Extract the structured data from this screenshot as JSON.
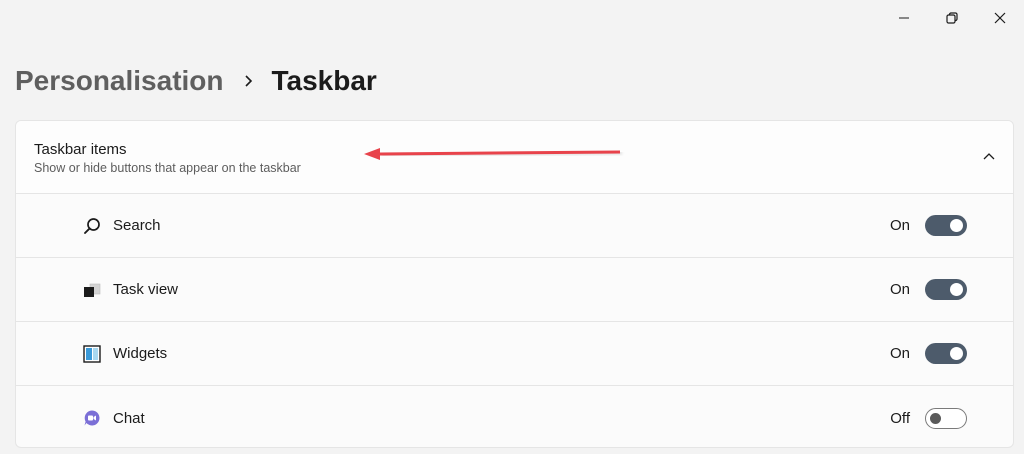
{
  "window": {
    "minimize_icon": "minimize-icon",
    "restore_icon": "restore-icon",
    "close_icon": "close-icon"
  },
  "breadcrumb": {
    "parent": "Personalisation",
    "current": "Taskbar"
  },
  "section": {
    "title": "Taskbar items",
    "subtitle": "Show or hide buttons that appear on the taskbar",
    "expanded": true
  },
  "items": [
    {
      "label": "Search",
      "state": "On",
      "enabled": true,
      "icon": "search-icon"
    },
    {
      "label": "Task view",
      "state": "On",
      "enabled": true,
      "icon": "task-view-icon"
    },
    {
      "label": "Widgets",
      "state": "On",
      "enabled": true,
      "icon": "widgets-icon"
    },
    {
      "label": "Chat",
      "state": "Off",
      "enabled": false,
      "icon": "chat-icon"
    }
  ],
  "colors": {
    "toggle_on": "#4d5b6b",
    "annotation_arrow": "#e8434b",
    "chat_icon": "#7b6fd6",
    "widgets_icon": "#3a9ad9"
  }
}
